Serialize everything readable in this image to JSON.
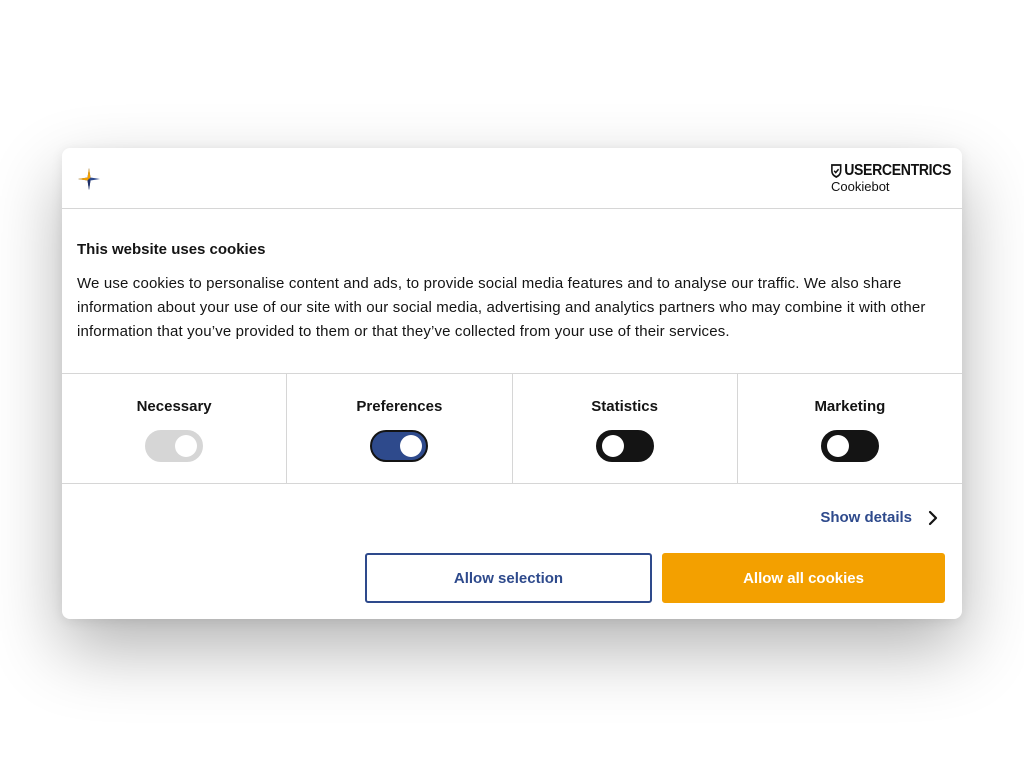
{
  "dialog": {
    "title": "This website uses cookies",
    "body": "We use cookies to personalise content and ads, to provide social media features and to analyse our traffic. We also share information about your use of our site with our social media, advertising and analytics partners who may combine it with other information that you’ve provided to them or that they’ve collected from your use of their services."
  },
  "brand": {
    "site_logo_icon": "star-logo-icon",
    "usercentrics": "USERCENTRICS",
    "cookiebot": "Cookiebot"
  },
  "toggles": [
    {
      "label": "Necessary",
      "state": "on",
      "disabled": true
    },
    {
      "label": "Preferences",
      "state": "on",
      "disabled": false
    },
    {
      "label": "Statistics",
      "state": "off",
      "disabled": false
    },
    {
      "label": "Marketing",
      "state": "off",
      "disabled": false
    }
  ],
  "actions": {
    "show_details": "Show details",
    "allow_selection": "Allow selection",
    "allow_all": "Allow all cookies"
  },
  "colors": {
    "accent_blue": "#2e4a8c",
    "primary_orange": "#f3a000",
    "divider": "#d6d6d6"
  }
}
